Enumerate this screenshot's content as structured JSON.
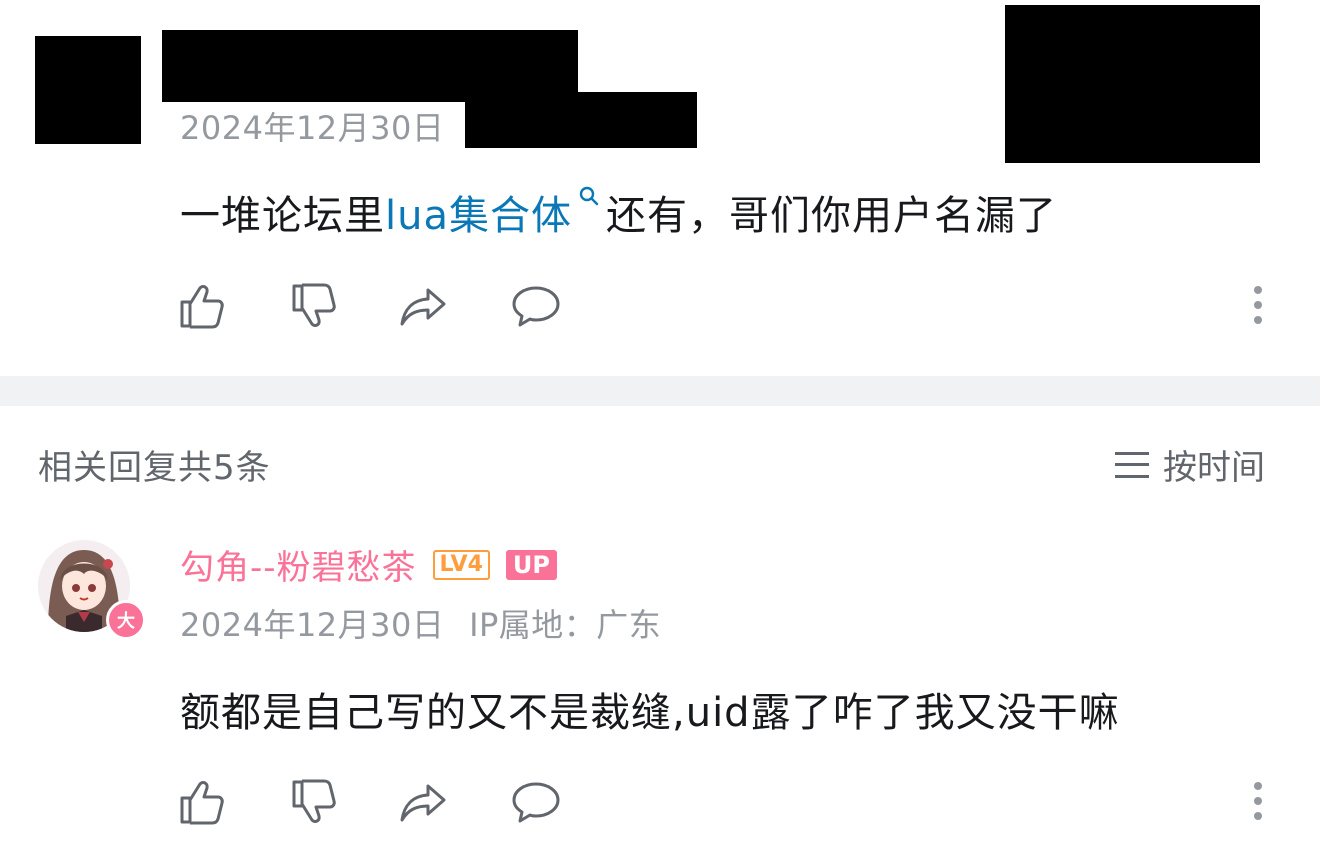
{
  "top_comment": {
    "date": "2024年12月30日",
    "text_before_link": "一堆论坛里",
    "link_text": "lua集合体",
    "text_after_link": "还有，哥们你用户名漏了"
  },
  "replies_header": {
    "title": "相关回复共5条",
    "sort_label": "按时间"
  },
  "reply": {
    "username": "勾角--粉碧愁茶",
    "level_badge": "LV4",
    "up_badge": "UP",
    "avatar_badge": "大",
    "date": "2024年12月30日",
    "ip_location": "IP属地：广东",
    "text": "额都是自己写的又不是裁缝,uid露了咋了我又没干嘛"
  },
  "colors": {
    "link": "#0a78b6",
    "username": "#fb7299",
    "level_badge": "#ff9c3c",
    "meta": "#9499a0",
    "divider": "#f1f2f3"
  },
  "icons": [
    "like-icon",
    "dislike-icon",
    "share-icon",
    "comment-icon",
    "more-icon",
    "search-icon",
    "sort-icon"
  ]
}
